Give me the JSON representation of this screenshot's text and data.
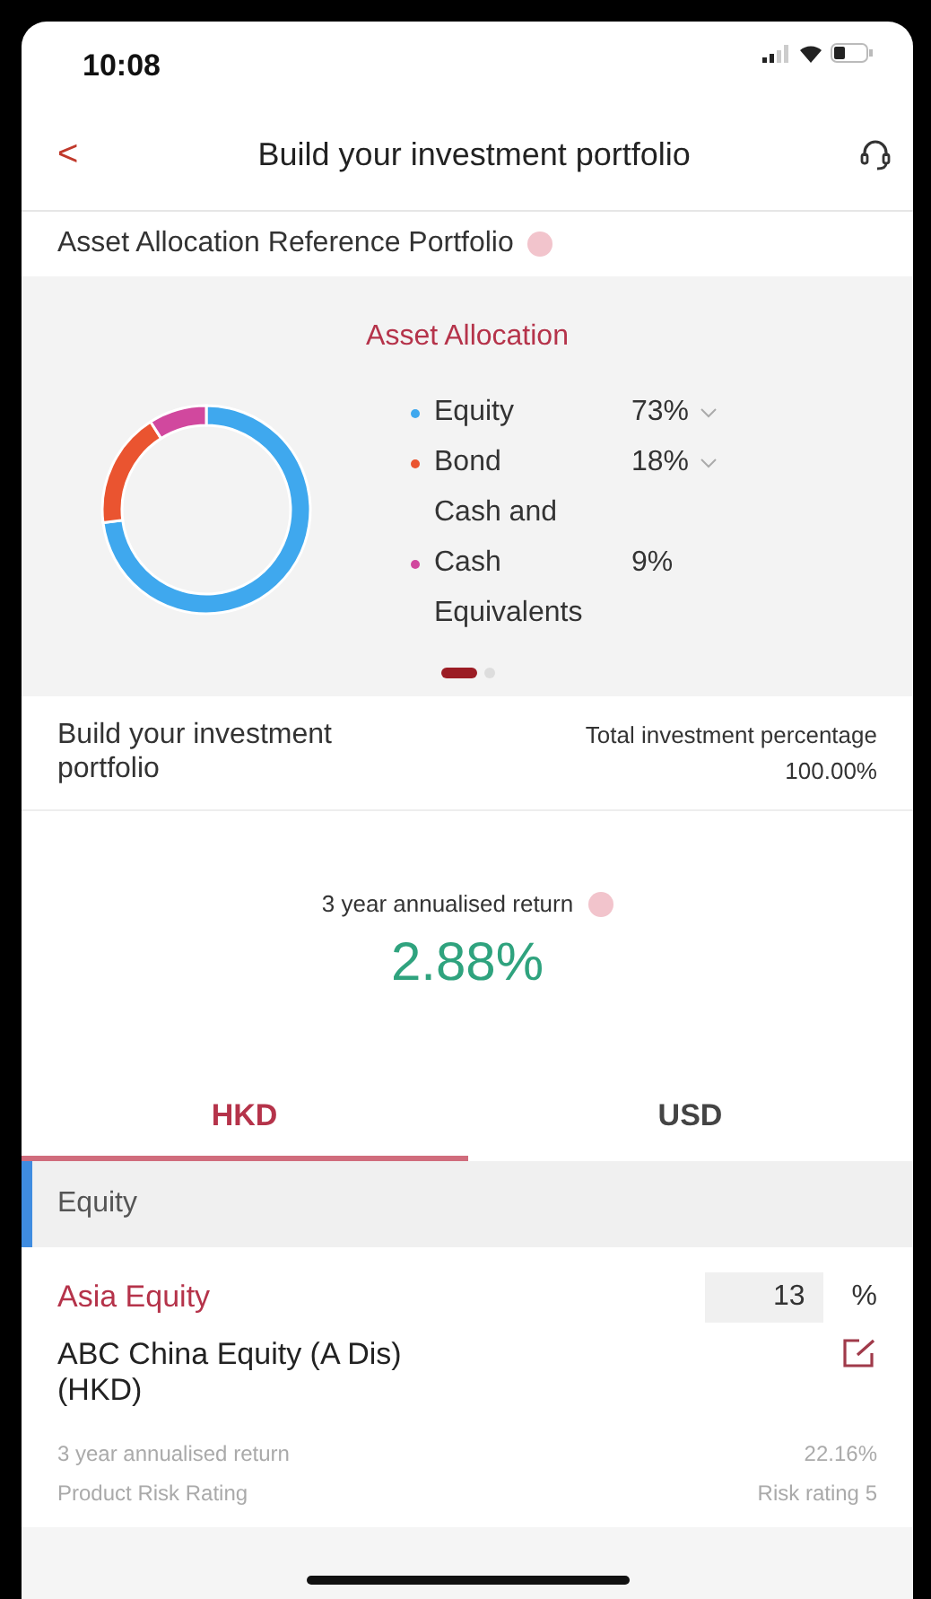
{
  "status_bar": {
    "time": "10:08"
  },
  "header": {
    "back": "<",
    "title": "Build your investment portfolio"
  },
  "reference": {
    "title": "Asset Allocation Reference Portfolio"
  },
  "allocation": {
    "title": "Asset Allocation",
    "legend": [
      {
        "label": "Equity",
        "value": "73%",
        "color": "#3fa8ee",
        "expandable": true
      },
      {
        "label": "Bond",
        "value": "18%",
        "color": "#ea5430",
        "expandable": true
      },
      {
        "label": "Cash and Cash Equivalents",
        "value": "9%",
        "color": "#d1489e",
        "expandable": false
      }
    ],
    "pager": [
      {
        "selected": true
      },
      {
        "selected": false
      }
    ]
  },
  "build": {
    "title": "Build your investment portfolio",
    "total_label": "Total investment percentage",
    "total_value": "100.00%"
  },
  "annualised": {
    "label": "3 year annualised return",
    "value": "2.88%"
  },
  "tabs": [
    {
      "label": "HKD",
      "selected": true
    },
    {
      "label": "USD",
      "selected": false
    }
  ],
  "section": {
    "title": "Equity"
  },
  "holdings": [
    {
      "category": "Asia Equity",
      "percent": "13",
      "unit": "%",
      "fund": "ABC China Equity (A Dis) (HKD)",
      "return_label": "3 year annualised return",
      "return_value": "22.16%",
      "risk_label": "Product Risk Rating",
      "risk_value": "Risk rating 5"
    }
  ]
}
